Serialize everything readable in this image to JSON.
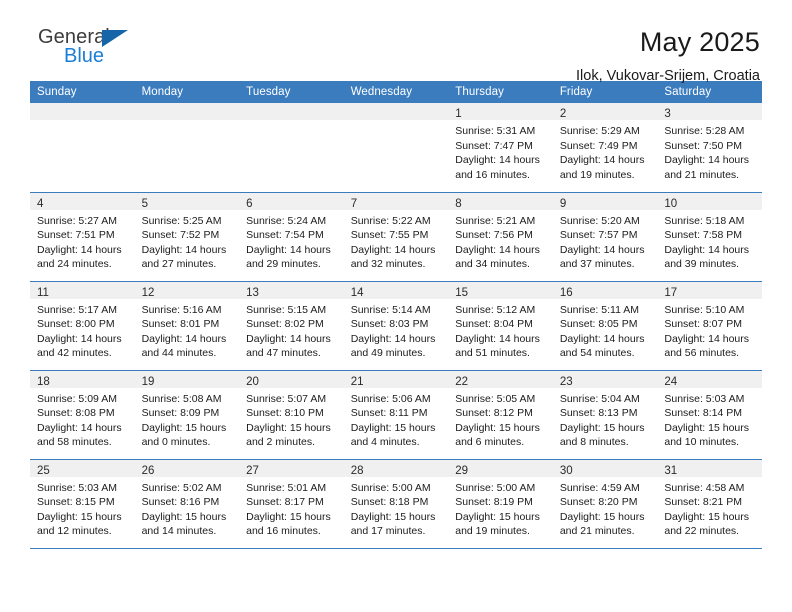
{
  "brand": {
    "line1": "General",
    "line2": "Blue",
    "flag_icon": "blue-triangle-flag"
  },
  "header": {
    "title": "May 2025",
    "location": "Ilok, Vukovar-Srijem, Croatia"
  },
  "colors": {
    "header_blue": "#3b7cbf",
    "brand_blue": "#1a7fd4",
    "daynum_bg": "#f0f0f0",
    "text": "#1c1c1c"
  },
  "calendar": {
    "weekday_headers": [
      "Sunday",
      "Monday",
      "Tuesday",
      "Wednesday",
      "Thursday",
      "Friday",
      "Saturday"
    ],
    "weeks": [
      [
        {
          "day": "",
          "sunrise": "",
          "sunset": "",
          "daylight_line1": "",
          "daylight_line2": ""
        },
        {
          "day": "",
          "sunrise": "",
          "sunset": "",
          "daylight_line1": "",
          "daylight_line2": ""
        },
        {
          "day": "",
          "sunrise": "",
          "sunset": "",
          "daylight_line1": "",
          "daylight_line2": ""
        },
        {
          "day": "",
          "sunrise": "",
          "sunset": "",
          "daylight_line1": "",
          "daylight_line2": ""
        },
        {
          "day": "1",
          "sunrise": "Sunrise: 5:31 AM",
          "sunset": "Sunset: 7:47 PM",
          "daylight_line1": "Daylight: 14 hours",
          "daylight_line2": "and 16 minutes."
        },
        {
          "day": "2",
          "sunrise": "Sunrise: 5:29 AM",
          "sunset": "Sunset: 7:49 PM",
          "daylight_line1": "Daylight: 14 hours",
          "daylight_line2": "and 19 minutes."
        },
        {
          "day": "3",
          "sunrise": "Sunrise: 5:28 AM",
          "sunset": "Sunset: 7:50 PM",
          "daylight_line1": "Daylight: 14 hours",
          "daylight_line2": "and 21 minutes."
        }
      ],
      [
        {
          "day": "4",
          "sunrise": "Sunrise: 5:27 AM",
          "sunset": "Sunset: 7:51 PM",
          "daylight_line1": "Daylight: 14 hours",
          "daylight_line2": "and 24 minutes."
        },
        {
          "day": "5",
          "sunrise": "Sunrise: 5:25 AM",
          "sunset": "Sunset: 7:52 PM",
          "daylight_line1": "Daylight: 14 hours",
          "daylight_line2": "and 27 minutes."
        },
        {
          "day": "6",
          "sunrise": "Sunrise: 5:24 AM",
          "sunset": "Sunset: 7:54 PM",
          "daylight_line1": "Daylight: 14 hours",
          "daylight_line2": "and 29 minutes."
        },
        {
          "day": "7",
          "sunrise": "Sunrise: 5:22 AM",
          "sunset": "Sunset: 7:55 PM",
          "daylight_line1": "Daylight: 14 hours",
          "daylight_line2": "and 32 minutes."
        },
        {
          "day": "8",
          "sunrise": "Sunrise: 5:21 AM",
          "sunset": "Sunset: 7:56 PM",
          "daylight_line1": "Daylight: 14 hours",
          "daylight_line2": "and 34 minutes."
        },
        {
          "day": "9",
          "sunrise": "Sunrise: 5:20 AM",
          "sunset": "Sunset: 7:57 PM",
          "daylight_line1": "Daylight: 14 hours",
          "daylight_line2": "and 37 minutes."
        },
        {
          "day": "10",
          "sunrise": "Sunrise: 5:18 AM",
          "sunset": "Sunset: 7:58 PM",
          "daylight_line1": "Daylight: 14 hours",
          "daylight_line2": "and 39 minutes."
        }
      ],
      [
        {
          "day": "11",
          "sunrise": "Sunrise: 5:17 AM",
          "sunset": "Sunset: 8:00 PM",
          "daylight_line1": "Daylight: 14 hours",
          "daylight_line2": "and 42 minutes."
        },
        {
          "day": "12",
          "sunrise": "Sunrise: 5:16 AM",
          "sunset": "Sunset: 8:01 PM",
          "daylight_line1": "Daylight: 14 hours",
          "daylight_line2": "and 44 minutes."
        },
        {
          "day": "13",
          "sunrise": "Sunrise: 5:15 AM",
          "sunset": "Sunset: 8:02 PM",
          "daylight_line1": "Daylight: 14 hours",
          "daylight_line2": "and 47 minutes."
        },
        {
          "day": "14",
          "sunrise": "Sunrise: 5:14 AM",
          "sunset": "Sunset: 8:03 PM",
          "daylight_line1": "Daylight: 14 hours",
          "daylight_line2": "and 49 minutes."
        },
        {
          "day": "15",
          "sunrise": "Sunrise: 5:12 AM",
          "sunset": "Sunset: 8:04 PM",
          "daylight_line1": "Daylight: 14 hours",
          "daylight_line2": "and 51 minutes."
        },
        {
          "day": "16",
          "sunrise": "Sunrise: 5:11 AM",
          "sunset": "Sunset: 8:05 PM",
          "daylight_line1": "Daylight: 14 hours",
          "daylight_line2": "and 54 minutes."
        },
        {
          "day": "17",
          "sunrise": "Sunrise: 5:10 AM",
          "sunset": "Sunset: 8:07 PM",
          "daylight_line1": "Daylight: 14 hours",
          "daylight_line2": "and 56 minutes."
        }
      ],
      [
        {
          "day": "18",
          "sunrise": "Sunrise: 5:09 AM",
          "sunset": "Sunset: 8:08 PM",
          "daylight_line1": "Daylight: 14 hours",
          "daylight_line2": "and 58 minutes."
        },
        {
          "day": "19",
          "sunrise": "Sunrise: 5:08 AM",
          "sunset": "Sunset: 8:09 PM",
          "daylight_line1": "Daylight: 15 hours",
          "daylight_line2": "and 0 minutes."
        },
        {
          "day": "20",
          "sunrise": "Sunrise: 5:07 AM",
          "sunset": "Sunset: 8:10 PM",
          "daylight_line1": "Daylight: 15 hours",
          "daylight_line2": "and 2 minutes."
        },
        {
          "day": "21",
          "sunrise": "Sunrise: 5:06 AM",
          "sunset": "Sunset: 8:11 PM",
          "daylight_line1": "Daylight: 15 hours",
          "daylight_line2": "and 4 minutes."
        },
        {
          "day": "22",
          "sunrise": "Sunrise: 5:05 AM",
          "sunset": "Sunset: 8:12 PM",
          "daylight_line1": "Daylight: 15 hours",
          "daylight_line2": "and 6 minutes."
        },
        {
          "day": "23",
          "sunrise": "Sunrise: 5:04 AM",
          "sunset": "Sunset: 8:13 PM",
          "daylight_line1": "Daylight: 15 hours",
          "daylight_line2": "and 8 minutes."
        },
        {
          "day": "24",
          "sunrise": "Sunrise: 5:03 AM",
          "sunset": "Sunset: 8:14 PM",
          "daylight_line1": "Daylight: 15 hours",
          "daylight_line2": "and 10 minutes."
        }
      ],
      [
        {
          "day": "25",
          "sunrise": "Sunrise: 5:03 AM",
          "sunset": "Sunset: 8:15 PM",
          "daylight_line1": "Daylight: 15 hours",
          "daylight_line2": "and 12 minutes."
        },
        {
          "day": "26",
          "sunrise": "Sunrise: 5:02 AM",
          "sunset": "Sunset: 8:16 PM",
          "daylight_line1": "Daylight: 15 hours",
          "daylight_line2": "and 14 minutes."
        },
        {
          "day": "27",
          "sunrise": "Sunrise: 5:01 AM",
          "sunset": "Sunset: 8:17 PM",
          "daylight_line1": "Daylight: 15 hours",
          "daylight_line2": "and 16 minutes."
        },
        {
          "day": "28",
          "sunrise": "Sunrise: 5:00 AM",
          "sunset": "Sunset: 8:18 PM",
          "daylight_line1": "Daylight: 15 hours",
          "daylight_line2": "and 17 minutes."
        },
        {
          "day": "29",
          "sunrise": "Sunrise: 5:00 AM",
          "sunset": "Sunset: 8:19 PM",
          "daylight_line1": "Daylight: 15 hours",
          "daylight_line2": "and 19 minutes."
        },
        {
          "day": "30",
          "sunrise": "Sunrise: 4:59 AM",
          "sunset": "Sunset: 8:20 PM",
          "daylight_line1": "Daylight: 15 hours",
          "daylight_line2": "and 21 minutes."
        },
        {
          "day": "31",
          "sunrise": "Sunrise: 4:58 AM",
          "sunset": "Sunset: 8:21 PM",
          "daylight_line1": "Daylight: 15 hours",
          "daylight_line2": "and 22 minutes."
        }
      ]
    ]
  }
}
